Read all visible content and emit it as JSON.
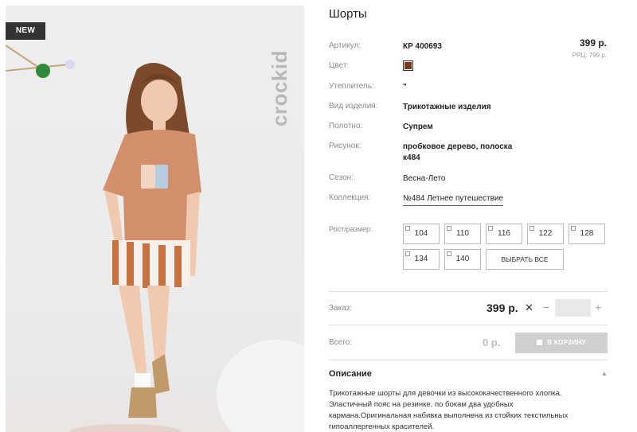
{
  "badge": "NEW",
  "brand": "crockid",
  "product": {
    "title": "Шорты",
    "price": "399 р.",
    "rrc": "РРЦ: 799 р.",
    "color_hex": "#7a3a22"
  },
  "attributes": {
    "article": {
      "label": "Артикул:",
      "value": "КР 400693"
    },
    "color": {
      "label": "Цвет:"
    },
    "insulation": {
      "label": "Утеплитель:",
      "value": "\""
    },
    "type": {
      "label": "Вид изделия:",
      "value": "Трикотажные изделия"
    },
    "fabric": {
      "label": "Полотно:",
      "value": "Супрем"
    },
    "pattern": {
      "label": "Рисунок:",
      "value_line1": "пробковое дерево, полоска",
      "value_line2": "к484"
    },
    "season": {
      "label": "Сезон:",
      "value": "Весна-Лето"
    },
    "collection": {
      "label": "Коллекция:",
      "value": "№484 Летнее путешествие"
    }
  },
  "sizes": {
    "label": "Рост/размер:",
    "options": [
      "104",
      "110",
      "116",
      "122",
      "128",
      "134",
      "140"
    ],
    "select_all": "ВЫБРАТЬ ВСЕ"
  },
  "order": {
    "label": "Заказ:",
    "price": "399 р.",
    "quantity": ""
  },
  "total": {
    "label": "Всего:",
    "price": "0 р.",
    "cart_button": "В КОРЗИНУ"
  },
  "description": {
    "heading": "Описание",
    "text_line1": "Трикотажные шорты для девочки из высококачественного хлопка.",
    "text_line2": "Эластичный пояс на резинке, по бокам два удобных",
    "text_line3": "кармана.Оригинальная набивка выполнена из стойких текстильных",
    "text_line4": "гипоаллергенных красителей."
  }
}
